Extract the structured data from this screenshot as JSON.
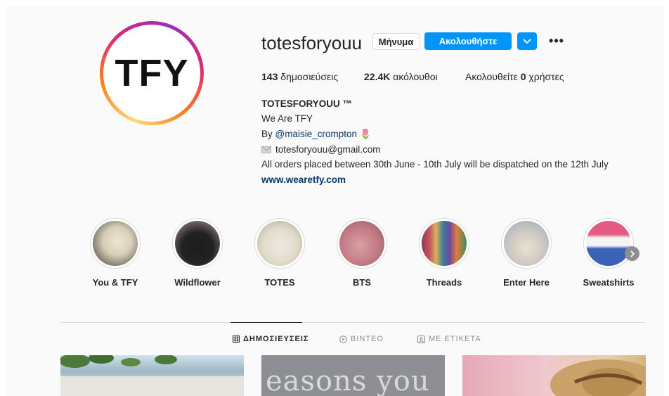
{
  "profile": {
    "avatar_text": "TFY",
    "username": "totesforyouu",
    "message_label": "Μήνυμα",
    "follow_label": "Ακολουθήστε",
    "more_label": "•••"
  },
  "stats": {
    "posts_count": "143",
    "posts_label": "δημοσιεύσεις",
    "followers_count": "22.4K",
    "followers_label": "ακόλουθοι",
    "following_prefix": "Ακολουθείτε",
    "following_count": "0",
    "following_suffix": "χρήστες"
  },
  "bio": {
    "name": "TOTESFORYOUU ™",
    "line1": "We Are TFY",
    "by_prefix": "By",
    "mention": "@maisie_crompton",
    "emoji": "🌷",
    "email": "totesforyouu@gmail.com",
    "notice": "All orders placed between 30th June - 10th July will be dispatched on the 12th July",
    "website": "www.wearetfy.com"
  },
  "highlights": [
    {
      "label": "You & TFY",
      "icon": "tote-bag-photo"
    },
    {
      "label": "Wildflower",
      "icon": "black-tote-photo"
    },
    {
      "label": "TOTES",
      "icon": "tote-photo"
    },
    {
      "label": "BTS",
      "icon": "pink-bags-photo"
    },
    {
      "label": "Threads",
      "icon": "thread-spools-photo"
    },
    {
      "label": "Enter Here",
      "icon": "hanging-tote-photo"
    },
    {
      "label": "Sweatshirts",
      "icon": "sweatshirts-photo"
    }
  ],
  "tabs": [
    {
      "label": "ΔΗΜΟΣΙΕΥΣΕΙΣ",
      "icon": "grid-icon",
      "active": true
    },
    {
      "label": "ΒΙΝΤΕΟ",
      "icon": "video-icon",
      "active": false
    },
    {
      "label": "ΜΕ ΕΤΙΚΕΤΑ",
      "icon": "tagged-icon",
      "active": false
    }
  ],
  "posts": [
    {
      "text": ""
    },
    {
      "text": "easons you"
    },
    {
      "text": ""
    }
  ],
  "colors": {
    "accent": "#0095f6",
    "link": "#00376b",
    "text": "#262626",
    "muted": "#8e8e8e"
  }
}
